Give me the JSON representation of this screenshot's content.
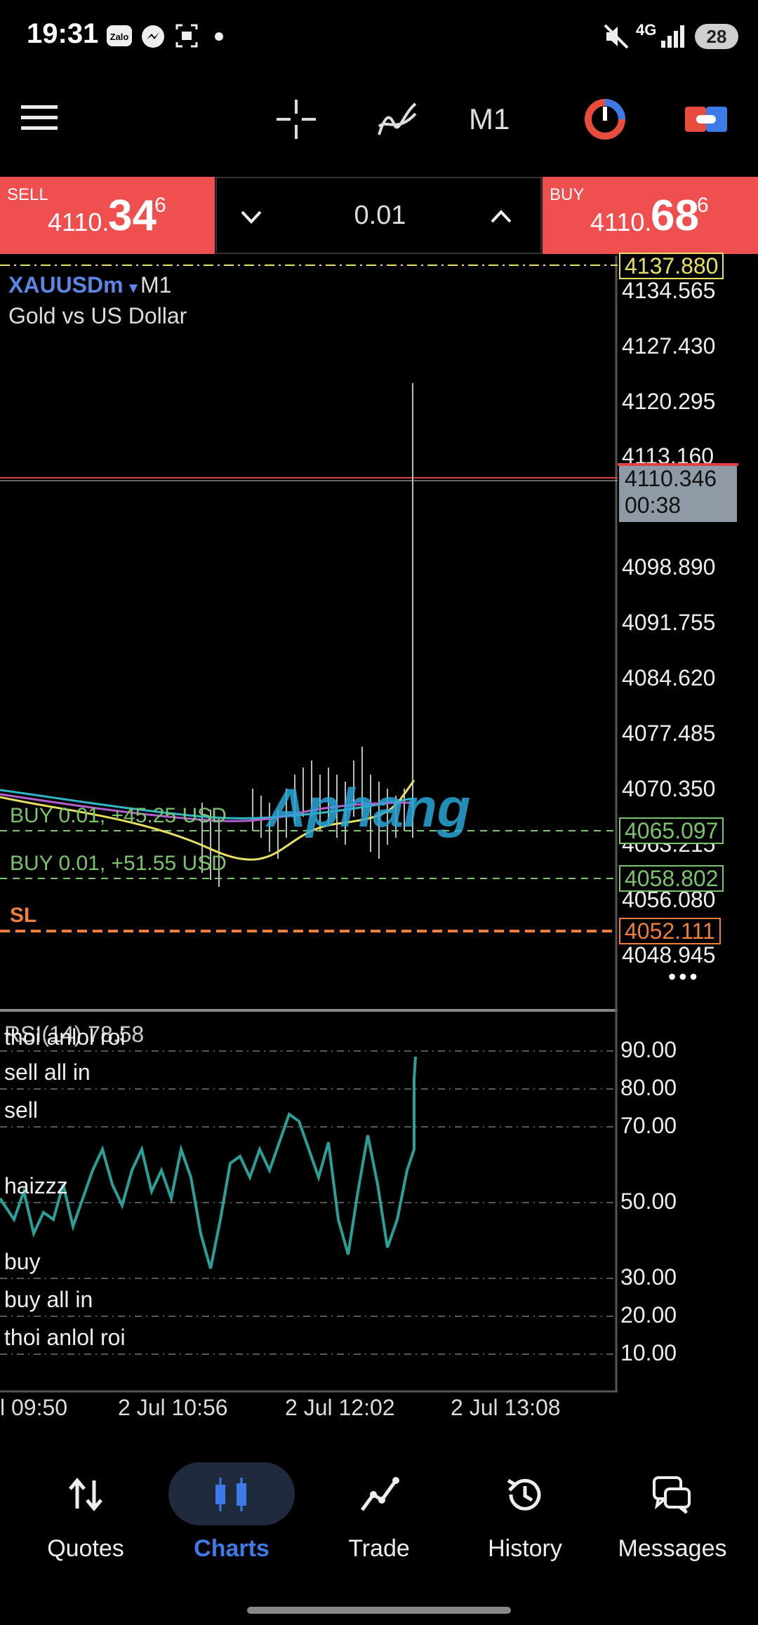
{
  "status": {
    "time": "19:31",
    "network": "4G",
    "battery": "28"
  },
  "toolbar": {
    "timeframe": "M1"
  },
  "trade": {
    "sell": {
      "label": "SELL",
      "price_main": "4110.",
      "price_big": "34",
      "price_sup": "6"
    },
    "buy": {
      "label": "BUY",
      "price_main": "4110.",
      "price_big": "68",
      "price_sup": "6"
    },
    "lot": "0.01"
  },
  "chart": {
    "symbol": "XAUUSDm",
    "symbol_caret": "▾",
    "timeframe": "M1",
    "description": "Gold vs US Dollar",
    "price_axis": [
      "4134.565",
      "4127.430",
      "4120.295",
      "4113.160",
      "4098.890",
      "4091.755",
      "4084.620",
      "4077.485",
      "4070.350",
      "4063.215",
      "4056.080",
      "4048.945"
    ],
    "tags": {
      "high_line": "4137.880",
      "current_price": "4110.346",
      "countdown": "00:38",
      "order1": "4065.097",
      "order2": "4058.802",
      "stop_loss": "4052.111"
    },
    "orders": [
      {
        "label": "BUY 0.01,  +45.25 USD"
      },
      {
        "label": "BUY 0.01,  +51.55 USD"
      }
    ],
    "sl_label": "SL",
    "more": "•••",
    "watermark": "Aphang",
    "colors": {
      "buy_line": "#7ac46a",
      "sl_line": "#f07f3a",
      "price_line": "#e04040",
      "high_line": "#e8e060",
      "rsi_line": "#2aa198"
    }
  },
  "rsi": {
    "title": "RSI(14) 78.58",
    "levels": [
      "90.00",
      "80.00",
      "70.00",
      "50.00",
      "30.00",
      "20.00",
      "10.00"
    ],
    "notes": [
      "thoi anlol roi",
      "sell all in",
      "sell",
      "haizzz",
      "buy",
      "buy all in",
      "thoi anlol roi"
    ]
  },
  "xaxis": [
    "l 09:50",
    "2 Jul 10:56",
    "2 Jul 12:02",
    "2 Jul 13:08"
  ],
  "nav": {
    "items": [
      {
        "label": "Quotes",
        "icon": "arrows-updown-icon"
      },
      {
        "label": "Charts",
        "icon": "candles-icon"
      },
      {
        "label": "Trade",
        "icon": "trend-icon"
      },
      {
        "label": "History",
        "icon": "history-icon"
      },
      {
        "label": "Messages",
        "icon": "messages-icon"
      }
    ],
    "active": "Charts",
    "active_color": "#3d7be8"
  }
}
